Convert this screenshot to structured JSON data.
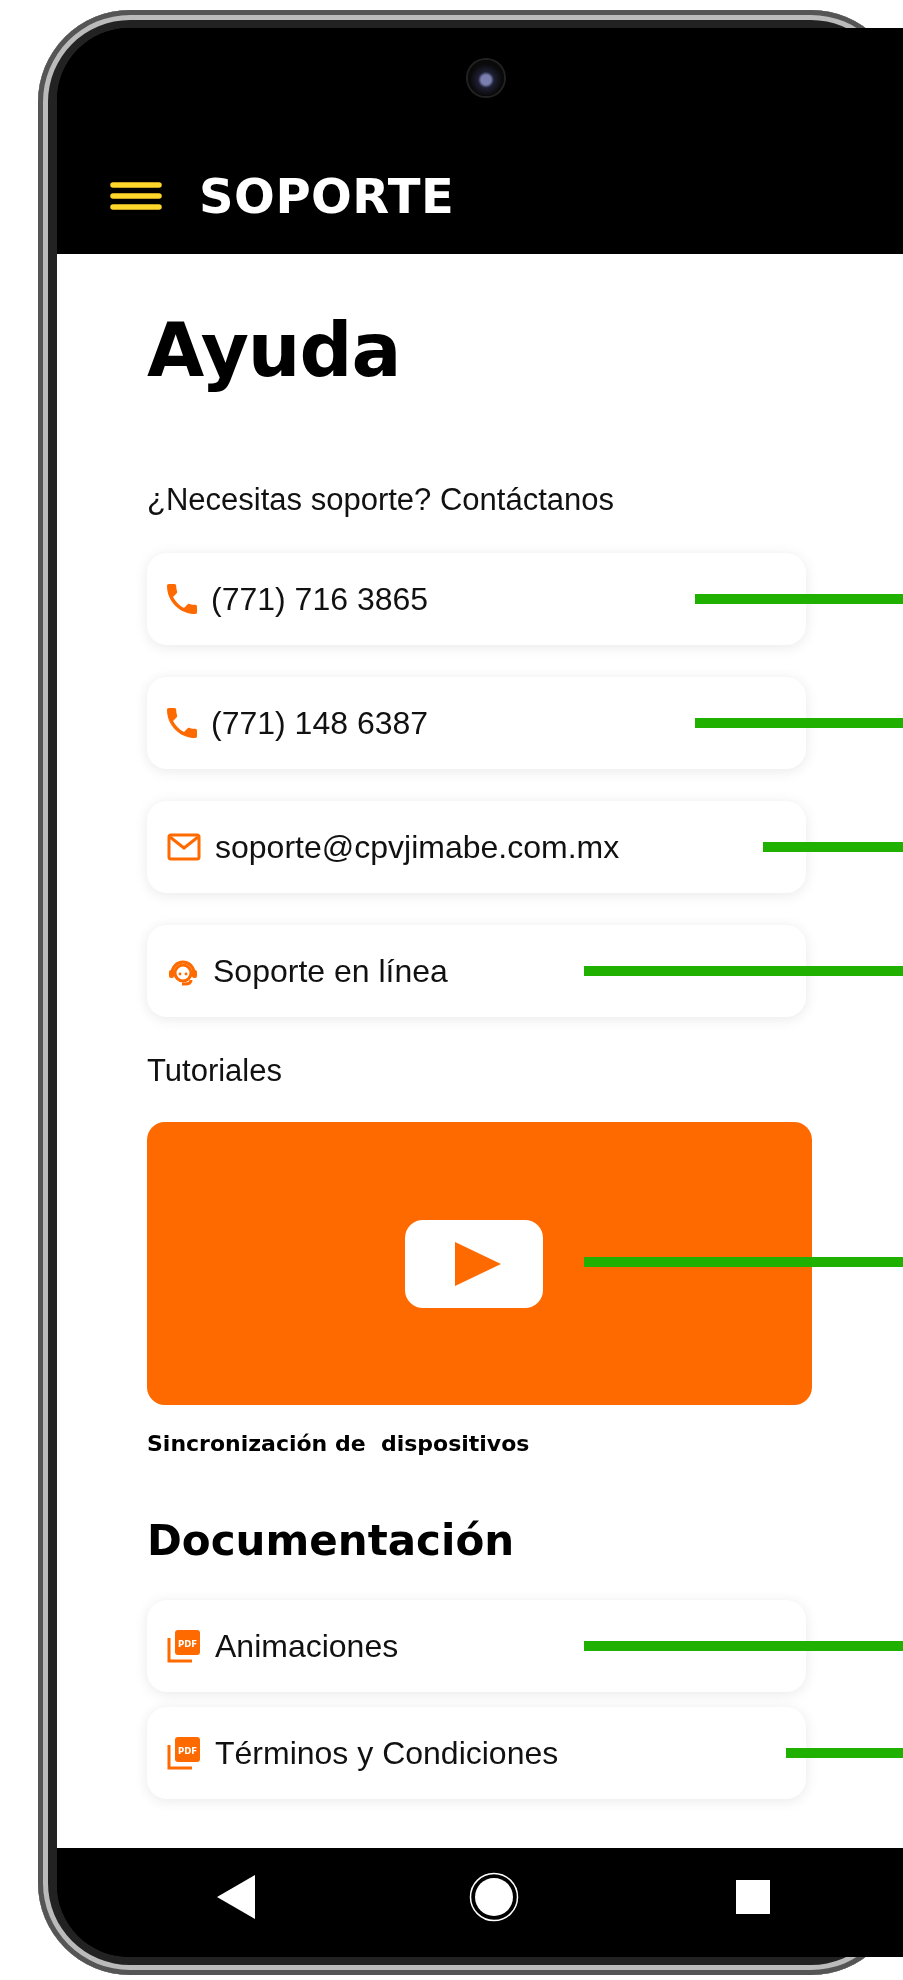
{
  "app_bar": {
    "title": "SOPORTE"
  },
  "page_title": "Ayuda",
  "contact_prompt": "¿Necesitas soporte? Contáctanos",
  "contacts": [
    {
      "kind": "phone",
      "label": "(771) 716 3865",
      "leader_line": true
    },
    {
      "kind": "phone",
      "label": "(771) 148 6387",
      "leader_line": true
    },
    {
      "kind": "email",
      "label": "soporte@cpvjimabe.com.mx",
      "leader_line": true
    },
    {
      "kind": "chat",
      "label": "Soporte en línea",
      "leader_line": true
    }
  ],
  "tutorials": {
    "heading": "Tutoriales",
    "videos": [
      {
        "caption": "Sincronización de  dispositivos",
        "leader_line": true
      }
    ]
  },
  "documentation": {
    "heading": "Documentación",
    "documents": [
      {
        "kind": "pdf",
        "icon_label": "PDF",
        "label": "Animaciones",
        "leader_line": true
      },
      {
        "kind": "pdf",
        "icon_label": "PDF",
        "label": "Términos y Condiciones",
        "leader_line": true
      }
    ]
  }
}
